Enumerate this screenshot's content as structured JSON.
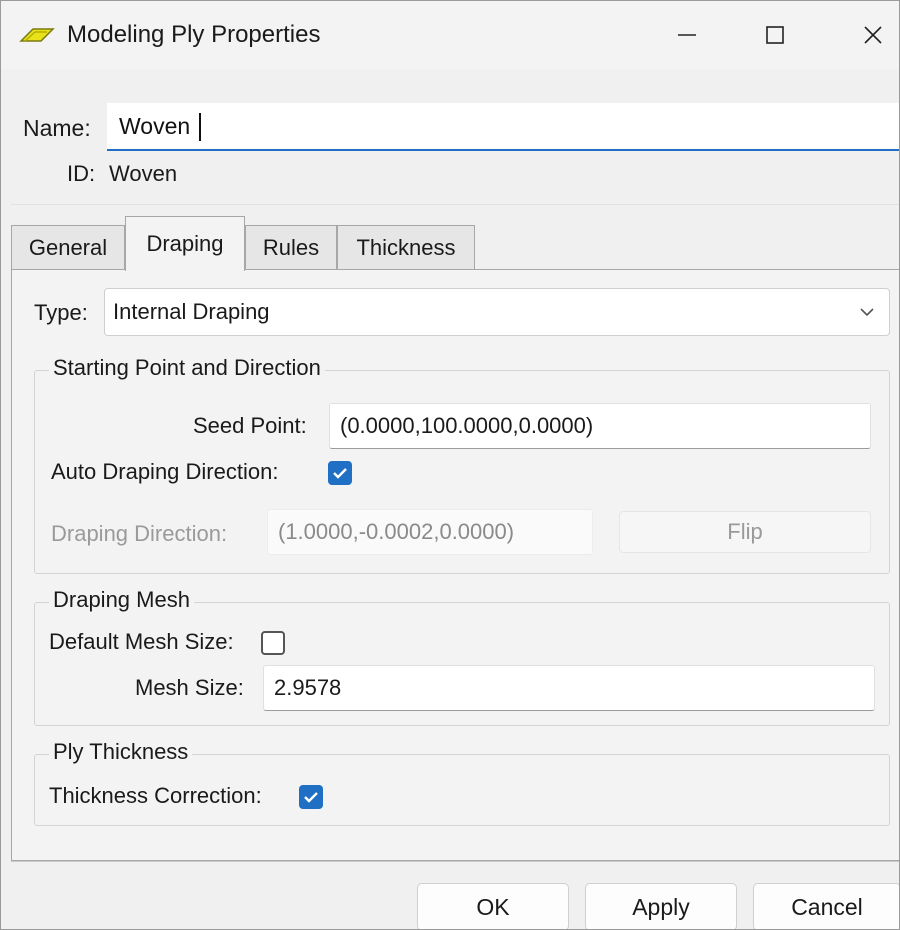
{
  "window": {
    "title": "Modeling Ply Properties",
    "icon": "ply-icon",
    "controls": [
      "minimize-icon",
      "maximize-icon",
      "close-icon"
    ]
  },
  "name": {
    "label": "Name:",
    "value": "Woven"
  },
  "id": {
    "label": "ID:",
    "value": "Woven"
  },
  "tabs": [
    {
      "label": "General",
      "active": false
    },
    {
      "label": "Draping",
      "active": true
    },
    {
      "label": "Rules",
      "active": false
    },
    {
      "label": "Thickness",
      "active": false
    }
  ],
  "draping": {
    "type_label": "Type:",
    "type_value": "Internal Draping",
    "starting_point": {
      "title": "Starting Point and Direction",
      "seed_point_label": "Seed Point:",
      "seed_point_value": "(0.0000,100.0000,0.0000)",
      "auto_direction_label": "Auto Draping Direction:",
      "auto_direction_checked": true,
      "direction_label": "Draping Direction:",
      "direction_value": "(1.0000,-0.0002,0.0000)",
      "flip_label": "Flip"
    },
    "mesh": {
      "title": "Draping Mesh",
      "default_mesh_label": "Default Mesh Size:",
      "default_mesh_checked": false,
      "mesh_size_label": "Mesh Size:",
      "mesh_size_value": "2.9578"
    },
    "ply_thickness": {
      "title": "Ply Thickness",
      "correction_label": "Thickness Correction:",
      "correction_checked": true
    }
  },
  "footer": {
    "ok": "OK",
    "apply": "Apply",
    "cancel": "Cancel"
  },
  "colors": {
    "accent": "#1f6fc4",
    "background": "#f3f3f3",
    "disabled_text": "#9a9a9a"
  }
}
